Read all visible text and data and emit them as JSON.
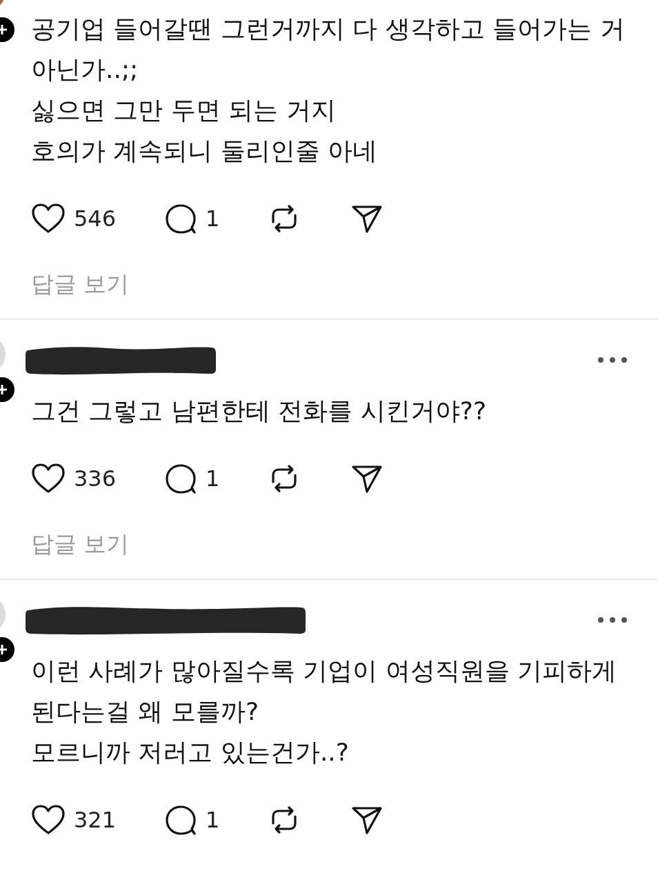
{
  "comments": [
    {
      "avatar": {
        "color": "#a0673a"
      },
      "text": "공기업 들어갈땐 그런거까지 다 생각하고 들어가는 거 아닌가..;;\n싫으면 그만 두면 되는 거지\n호의가 계속되니 둘리인줄 아네",
      "likes": "546",
      "replies": "1",
      "reply_link": "답글 보기"
    },
    {
      "avatar": {
        "color": "#dcdcdc"
      },
      "header": {
        "redacted": true
      },
      "text": "그건 그렇고 남편한테 전화를 시킨거야??",
      "likes": "336",
      "replies": "1",
      "reply_link": "답글 보기"
    },
    {
      "avatar": {
        "color": "#dcdcdc"
      },
      "header": {
        "redacted": true
      },
      "text": "이런 사례가 많아질수록 기업이 여성직원을 기피하게 된다는걸 왜 모를까?\n모르니까 저러고 있는건가..?",
      "likes": "321",
      "replies": "1"
    }
  ]
}
